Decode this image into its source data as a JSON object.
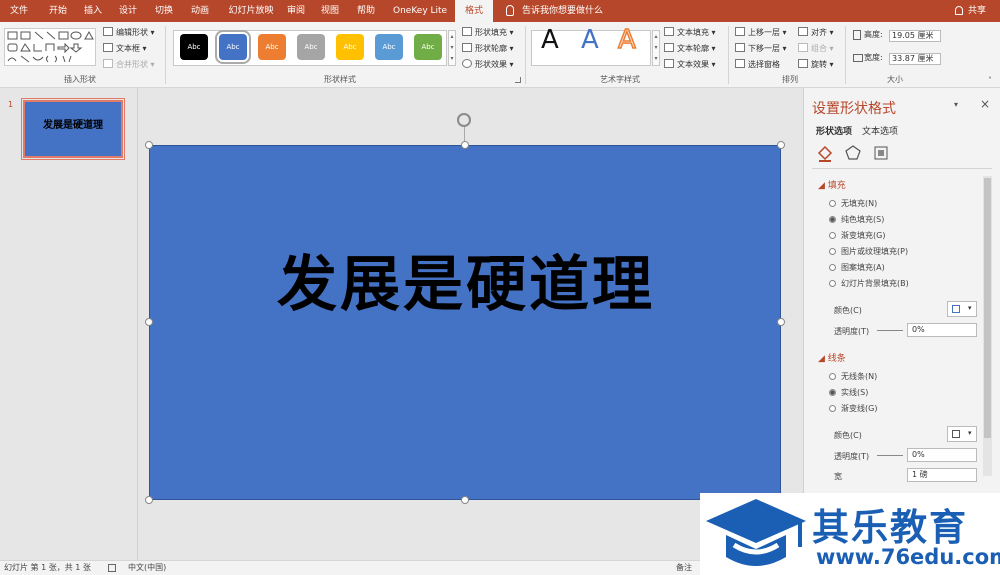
{
  "tabs": [
    {
      "label": "文件",
      "active": false
    },
    {
      "label": "开始",
      "active": false
    },
    {
      "label": "插入",
      "active": false
    },
    {
      "label": "设计",
      "active": false
    },
    {
      "label": "切换",
      "active": false
    },
    {
      "label": "动画",
      "active": false
    },
    {
      "label": "幻灯片放映",
      "active": false
    },
    {
      "label": "审阅",
      "active": false
    },
    {
      "label": "视图",
      "active": false
    },
    {
      "label": "帮助",
      "active": false
    },
    {
      "label": "OneKey Lite",
      "active": false
    },
    {
      "label": "格式",
      "active": true
    }
  ],
  "tell_me": "告诉我你想要做什么",
  "share": "共享",
  "ribbon": {
    "insert_shapes": {
      "label": "插入形状",
      "edit_shape": "编辑形状",
      "text_box": "文本框",
      "merge_shapes": "合并形状"
    },
    "shape_styles": {
      "label": "形状样式",
      "swatch_text": "Abc",
      "swatches": [
        "#000000",
        "#4472c4",
        "#ed7d31",
        "#a5a5a5",
        "#ffc000",
        "#5b9bd5",
        "#70ad47"
      ],
      "fill": "形状填充",
      "outline": "形状轮廓",
      "effects": "形状效果"
    },
    "wordart": {
      "label": "艺术字样式",
      "sample": "A",
      "text_fill": "文本填充",
      "text_outline": "文本轮廓",
      "text_effects": "文本效果"
    },
    "arrange": {
      "label": "排列",
      "bring_forward": "上移一层",
      "send_backward": "下移一层",
      "selection_pane": "选择窗格",
      "align": "对齐",
      "group": "组合",
      "rotate": "旋转"
    },
    "size": {
      "label": "大小",
      "height_label": "高度:",
      "height_value": "19.05 厘米",
      "width_label": "宽度:",
      "width_value": "33.87 厘米"
    }
  },
  "thumbnail": {
    "number": "1",
    "text": "发展是硬道理"
  },
  "slide": {
    "text": "发展是硬道理",
    "fill": "#4472c4"
  },
  "format_pane": {
    "title": "设置形状格式",
    "tab_shape": "形状选项",
    "tab_text": "文本选项",
    "fill_section": "填充",
    "fill_options": [
      {
        "label": "无填充(N)",
        "selected": false
      },
      {
        "label": "纯色填充(S)",
        "selected": true
      },
      {
        "label": "渐变填充(G)",
        "selected": false
      },
      {
        "label": "图片或纹理填充(P)",
        "selected": false
      },
      {
        "label": "图案填充(A)",
        "selected": false
      },
      {
        "label": "幻灯片背景填充(B)",
        "selected": false
      }
    ],
    "fill_color_label": "颜色(C)",
    "fill_transparency_label": "透明度(T)",
    "fill_transparency_value": "0%",
    "line_section": "线条",
    "line_options": [
      {
        "label": "无线条(N)",
        "selected": false
      },
      {
        "label": "实线(S)",
        "selected": true
      },
      {
        "label": "渐变线(G)",
        "selected": false
      }
    ],
    "line_color_label": "颜色(C)",
    "line_transparency_label": "透明度(T)",
    "line_transparency_value": "0%",
    "line_width_label": "宽",
    "line_width_value": "1 磅"
  },
  "status": {
    "slide_info": "幻灯片 第 1 张，共 1 张",
    "language": "中文(中国)",
    "notes": "备注"
  },
  "watermark": {
    "name": "其乐教育",
    "url": "www.76edu.com"
  }
}
